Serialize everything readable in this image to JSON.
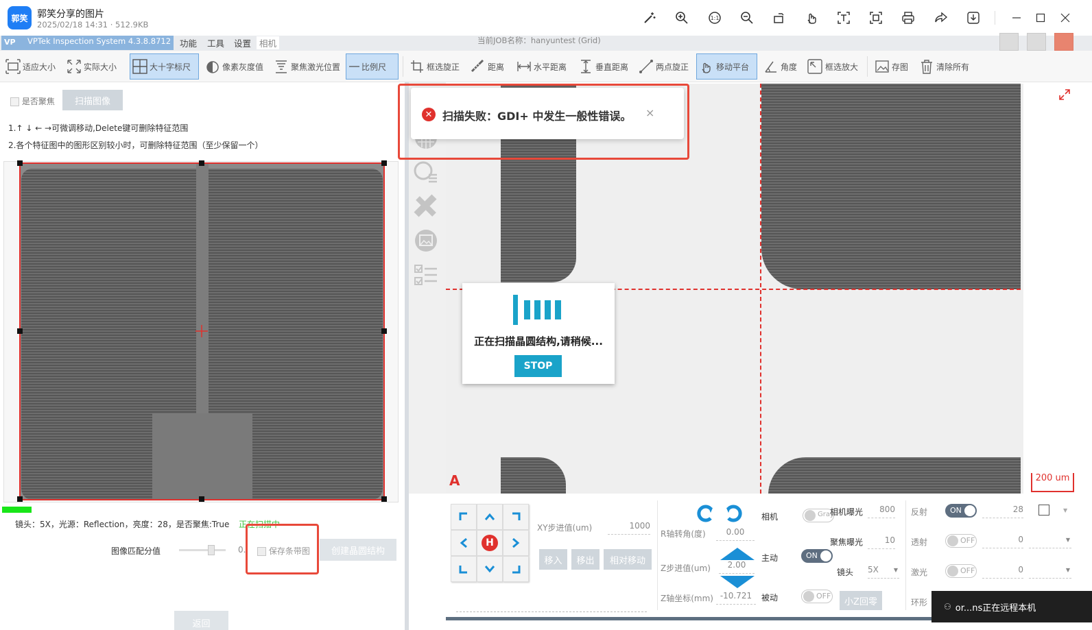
{
  "viewer": {
    "logo": "郭笑",
    "title": "郭笑分享的图片",
    "meta": "2025/02/18 14:31 · 512.9KB",
    "tools": [
      "magic-wand-icon",
      "zoom-in-icon",
      "actual-size-icon",
      "zoom-out-icon",
      "rotate-icon",
      "hand-icon",
      "ocr-icon",
      "crop-icon",
      "print-icon",
      "share-icon",
      "download-icon"
    ]
  },
  "app": {
    "title": "VPTek Inspection System 4.3.8.8712",
    "menus": [
      "功能",
      "工具",
      "设置",
      "相机"
    ],
    "job_label": "当前JOB名称：hanyuntest (Grid)"
  },
  "toolbar": {
    "fit": "适应大小",
    "actual": "实际大小",
    "cross": "大十字标尺",
    "pixel_gray": "像素灰度值",
    "focus_laser": "聚焦激光位置",
    "scale_bar": "比例尺",
    "box_rotate": "框选旋正",
    "distance": "距离",
    "h_distance": "水平距离",
    "v_distance": "垂直距离",
    "two_point": "两点旋正",
    "move_stage": "移动平台",
    "angle": "角度",
    "box_zoom": "框选放大",
    "save_img": "存图",
    "clear_all": "清除所有"
  },
  "left": {
    "focus_check": "是否聚焦",
    "scan_btn": "扫描图像",
    "hint1": "1.↑ ↓ ← →可微调移动,Delete键可删除特征范围",
    "hint2": "2.各个特征图中的图形区别较小时，可删除特征范围（至少保留一个）",
    "status": "镜头：5X，光源：Reflection，亮度：28，是否聚焦:True",
    "scanning": "正在扫描中",
    "match_label": "图像匹配分值",
    "match_value": "0.",
    "save_strip": "保存条带图",
    "create_btn": "创建晶圆结构",
    "back_btn": "返回"
  },
  "toast": {
    "message": "扫描失败：GDI+ 中发生一般性错误。",
    "close": "×"
  },
  "progress": {
    "message": "正在扫描晶圆结构,请稍候...",
    "stop": "STOP"
  },
  "image": {
    "letter": "A",
    "scale": "200 um"
  },
  "controls": {
    "xy_step_label": "XY步进值(um)",
    "xy_step": "1000",
    "move_in": "移入",
    "move_out": "移出",
    "rel_move": "相对移动",
    "r_angle_label": "R轴转角(度)",
    "r_angle": "0.00",
    "z_step_label": "Z步进值(um)",
    "z_step": "2.00",
    "z_coord_label": "Z轴坐标(mm)",
    "z_coord": "-10.721",
    "camera": "相机",
    "gray": "Gray",
    "active": "主动",
    "on": "ON",
    "passive": "被动",
    "off": "OFF",
    "small_z": "小Z回零",
    "cam_exposure": "相机曝光",
    "cam_exposure_val": "800",
    "focus_exposure": "聚焦曝光",
    "focus_exposure_val": "10",
    "lens": "镜头",
    "lens_val": "5X",
    "reflect": "反射",
    "reflect_val": "28",
    "transmit": "透射",
    "transmit_val": "0",
    "laser": "激光",
    "laser_val": "0",
    "ring": "环形",
    "remote": "or...ns正在远程本机"
  },
  "colors": {
    "accent": "#1aa3c9",
    "alert": "#e0312d",
    "highlight": "#e8493a",
    "green": "#19e619"
  }
}
